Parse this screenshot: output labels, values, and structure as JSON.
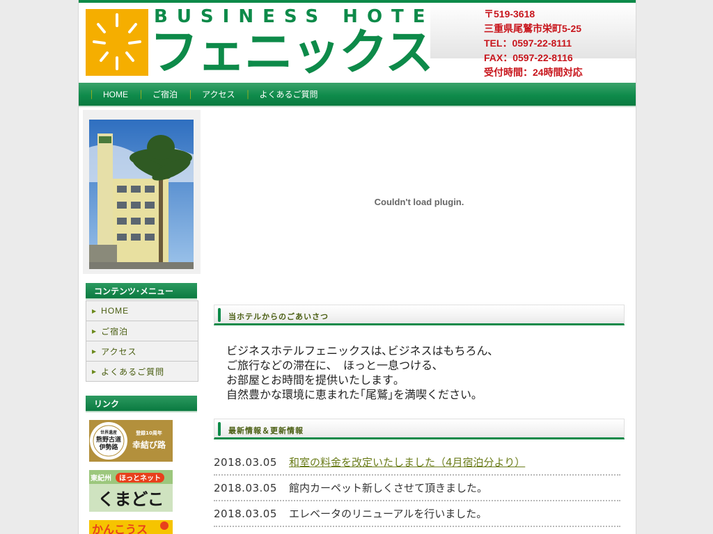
{
  "header": {
    "logo_en": "BUSINESS HOTEL",
    "logo_jp": "フェニックス",
    "contact": {
      "postal": "〒519-3618",
      "address": "三重県尾鷲市栄町5-25",
      "tel": "TEL：0597-22-8111",
      "fax": "FAX：0597-22-8116",
      "hours": "受付時間：24時間対応"
    }
  },
  "nav": {
    "separator": "｜",
    "items": [
      {
        "label": "HOME"
      },
      {
        "label": "ご宿泊"
      },
      {
        "label": "アクセス"
      },
      {
        "label": "よくあるご質問"
      }
    ]
  },
  "sidebar": {
    "menu_title": "コンテンツ･メニュー",
    "menu_items": [
      {
        "label": "HOME"
      },
      {
        "label": "ご宿泊"
      },
      {
        "label": "アクセス"
      },
      {
        "label": "よくあるご質問"
      }
    ],
    "links_title": "リンク",
    "banners": [
      {
        "lines": [
          "世界遺産",
          "熊野古道",
          "伊勢路",
          "登録10周年",
          "幸結び路"
        ]
      },
      {
        "lines": [
          "東紀州",
          "ほっとネット",
          "くまどこ"
        ]
      },
      {
        "lines": [
          "かんこうス"
        ]
      }
    ]
  },
  "main": {
    "plugin_message": "Couldn't load plugin.",
    "greeting_title": "当ホテルからのごあいさつ",
    "greeting_lines": [
      "ビジネスホテルフェニックスは､ビジネスはもちろん､",
      "ご旅行などの滞在に､　ほっと一息つける､",
      "お部屋とお時間を提供いたします｡",
      "自然豊かな環境に恵まれた｢尾鷲｣を満喫ください｡"
    ],
    "news_title": "最新情報＆更新情報",
    "news": [
      {
        "date": "2018.03.05",
        "text": "和室の料金を改定いたしました（4月宿泊分より）"
      },
      {
        "date": "2018.03.05",
        "text": "館内カーペット新しくさせて頂きました。"
      },
      {
        "date": "2018.03.05",
        "text": "エレベータのリニューアルを行いました。"
      }
    ]
  },
  "colors": {
    "brand_green": "#0d8a49",
    "logo_orange": "#f5ae00",
    "contact_red": "#c8161d",
    "link_olive": "#6b7d1b"
  }
}
